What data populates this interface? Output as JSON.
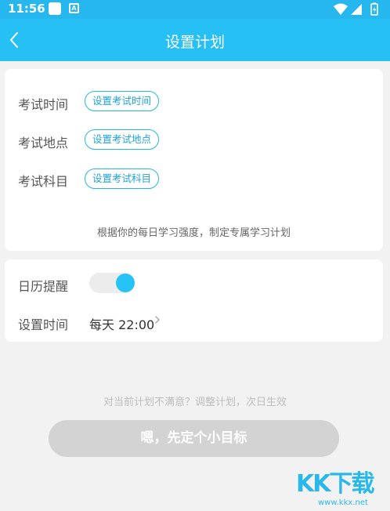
{
  "statusbar": {
    "time": "11:56",
    "icon_a": "A"
  },
  "nav": {
    "title": "设置计划",
    "back_icon": "chevron-left"
  },
  "plan": {
    "rows": [
      {
        "label": "考试时间",
        "button": "设置考试时间"
      },
      {
        "label": "考试地点",
        "button": "设置考试地点"
      },
      {
        "label": "考试科目",
        "button": "设置考试科目"
      }
    ],
    "hint": "根据你的每日学习强度，制定专属学习计划"
  },
  "calendar": {
    "reminder_label": "日历提醒",
    "reminder_on": true,
    "time_label": "设置时间",
    "time_value": "每天 22:00"
  },
  "footer": {
    "hint": "对当前计划不满意？调整计划，次日生效",
    "button": "嗯，先定个小目标"
  },
  "watermark": {
    "text": "KK下载",
    "url": "www.kkx.net"
  },
  "colors": {
    "primary": "#26c0f5",
    "button_disabled": "#d3d3d3"
  }
}
